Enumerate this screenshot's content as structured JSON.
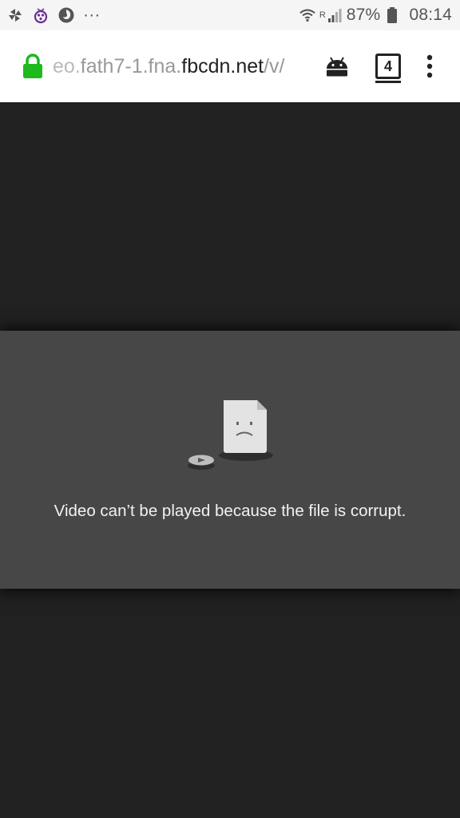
{
  "status_bar": {
    "left_icons": [
      "pinwheel-icon",
      "raspberry-icon",
      "firefox-icon",
      "more-notifications-icon"
    ],
    "more_text": "···",
    "wifi_icon": "wifi-icon",
    "signal_icon": "signal-icon",
    "roaming_label": "R",
    "battery_percent": "87%",
    "battery_icon": "battery-icon",
    "time": "08:14"
  },
  "browser": {
    "url_prefix_faded": "eo.",
    "url_main_a": "fath7-1.fna.",
    "url_domain": "fbcdn.net",
    "url_suffix": "/v/",
    "lock_color": "#1db91d",
    "tab_count": "4"
  },
  "player": {
    "error_message": "Video can’t be played because the file is corrupt."
  }
}
